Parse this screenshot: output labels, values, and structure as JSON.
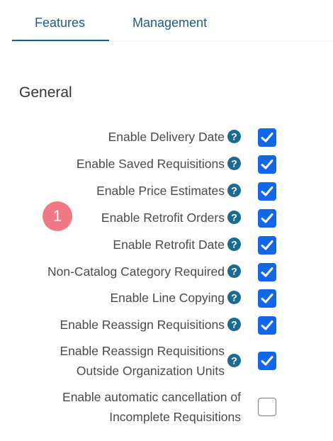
{
  "tabs": [
    {
      "label": "Features",
      "active": true
    },
    {
      "label": "Management",
      "active": false
    }
  ],
  "section_title": "General",
  "callout_number": "1",
  "colors": {
    "accent": "#1f5d80",
    "checkbox": "#1167e8",
    "help_icon": "#1a6b8f",
    "callout": "#f07985"
  },
  "settings": [
    {
      "label": "Enable Delivery Date",
      "checked": true
    },
    {
      "label": "Enable Saved Requisitions",
      "checked": true
    },
    {
      "label": "Enable Price Estimates",
      "checked": true
    },
    {
      "label": "Enable Retrofit Orders",
      "checked": true
    },
    {
      "label": "Enable Retrofit Date",
      "checked": true
    },
    {
      "label": "Non-Catalog Category Required",
      "checked": true
    },
    {
      "label": "Enable Line Copying",
      "checked": true
    },
    {
      "label": "Enable Reassign Requisitions",
      "checked": true
    },
    {
      "label_line1": "Enable Reassign Requisitions",
      "label_line2": "Outside Organization Units",
      "checked": true
    },
    {
      "label_line1": "Enable automatic cancellation of",
      "label_line2": "Incomplete Requisitions",
      "checked": false
    }
  ]
}
